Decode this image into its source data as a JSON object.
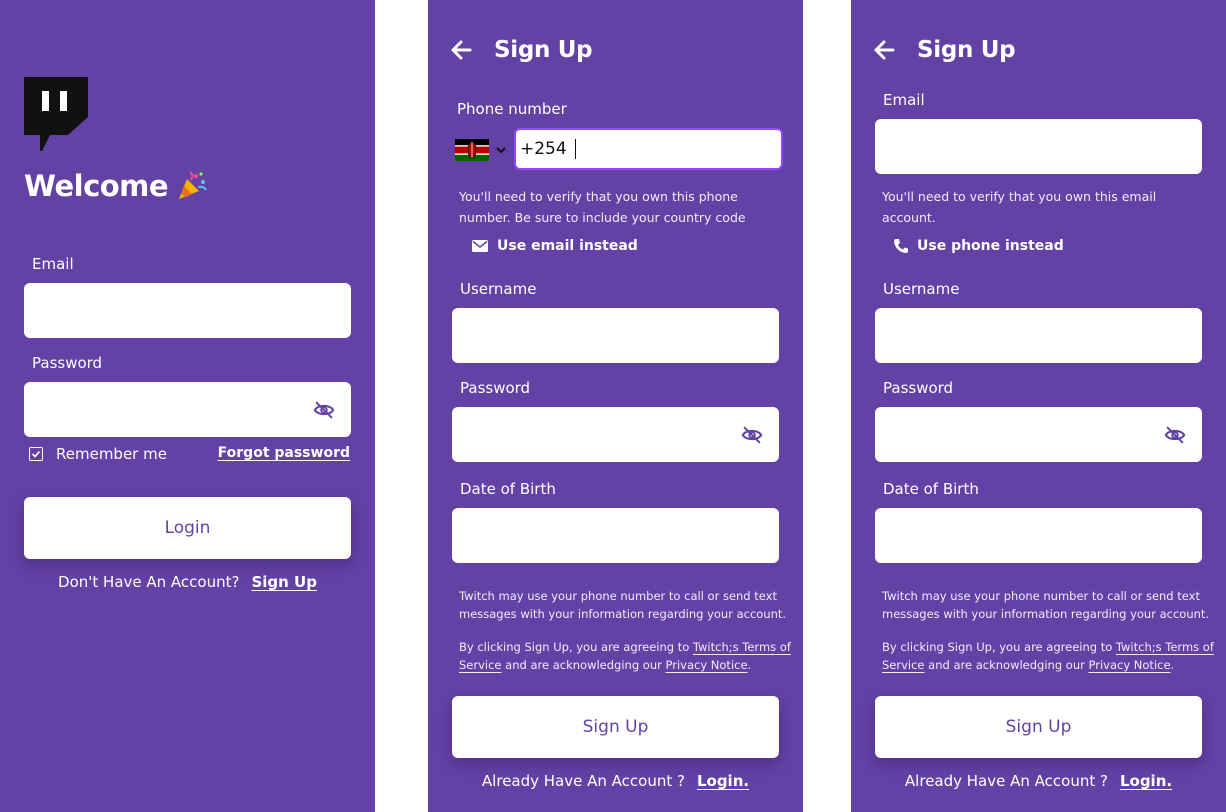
{
  "login": {
    "welcome": "Welcome",
    "email_label": "Email",
    "password_label": "Password",
    "remember_label": "Remember me",
    "forgot_label": "Forgot password",
    "login_button": "Login",
    "no_account_text": "Don't Have An Account?",
    "signup_link": "Sign Up"
  },
  "signup_phone": {
    "title": "Sign Up",
    "phone_label": "Phone number",
    "country_flag": "kenya-flag",
    "phone_value": "+254",
    "verify_note": "You'll need to verify that you own this phone number. Be sure to include your country code",
    "switch_label": "Use email instead",
    "username_label": "Username",
    "password_label": "Password",
    "dob_label": "Date of Birth",
    "sms_notice": "Twitch may use your phone number to call or send text messages with your information regarding your account.",
    "terms_prefix": "By clicking Sign Up, you are agreeing to",
    "terms_link_1": "Twitch;s Terms of",
    "terms_link_2": "Service",
    "terms_middle": "and are acknowledging our",
    "privacy_link": "Privacy Notice",
    "terms_end": ".",
    "signup_button": "Sign Up",
    "have_account_text": "Already Have An Account ?",
    "login_link": "Login."
  },
  "signup_email": {
    "title": "Sign Up",
    "email_label": "Email",
    "verify_note": "You'll need to verify that you own this email account.",
    "switch_label": "Use phone instead",
    "username_label": "Username",
    "password_label": "Password",
    "dob_label": "Date of Birth",
    "sms_notice": "Twitch may use your phone number to call or send text messages with your information regarding your account.",
    "terms_prefix": "By clicking Sign Up, you are agreeing to",
    "terms_link_1": "Twitch;s Terms of",
    "terms_link_2": "Service",
    "terms_middle": "and are acknowledging our",
    "privacy_link": "Privacy Notice",
    "terms_end": ".",
    "signup_button": "Sign Up",
    "have_account_text": "Already Have An Account ?",
    "login_link": "Login."
  },
  "colors": {
    "panel_bg": "#6441a5",
    "field_bg": "#ffffff",
    "focus_border": "#9147ff"
  }
}
